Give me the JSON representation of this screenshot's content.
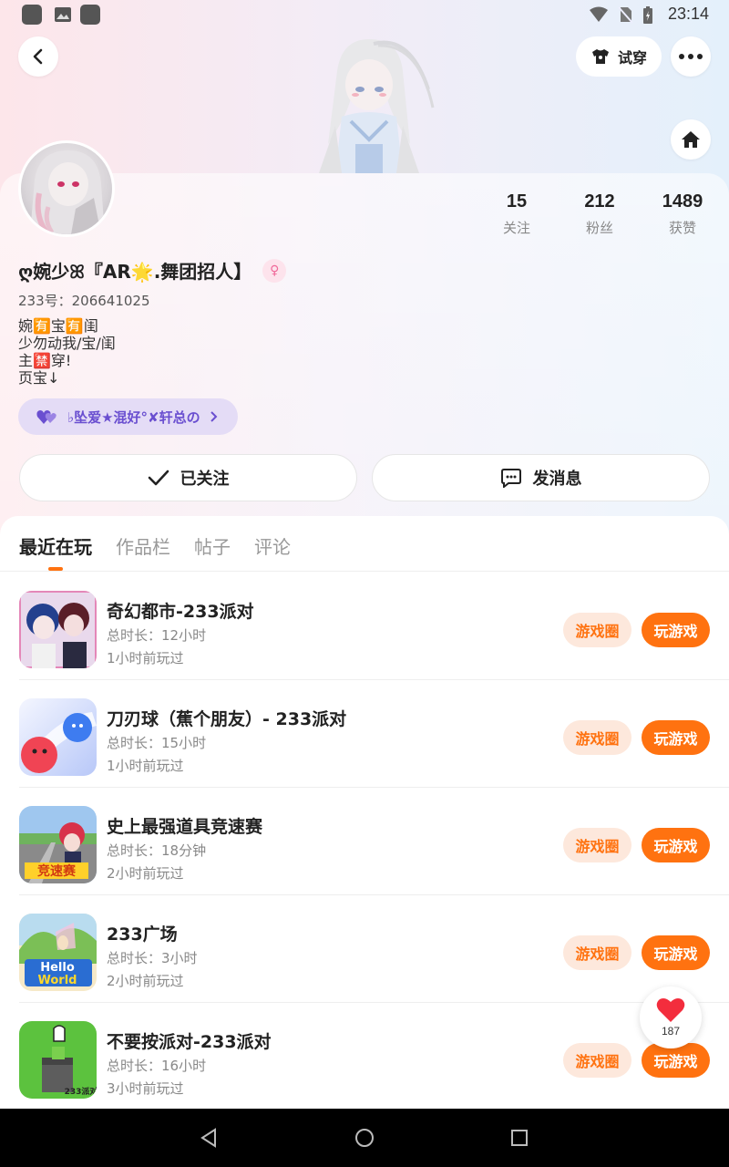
{
  "status_bar": {
    "time": "23:14"
  },
  "header": {
    "tryon_label": "试穿"
  },
  "profile": {
    "nickname": "ღ婉少ꕤ『AR🌟.舞团招人】",
    "gender_symbol": "♀",
    "uid": "233号：206641025",
    "bio_lines": [
      "婉🈶宝🈶闺",
      "少勿动我/宝/闺",
      "主🈲穿!",
      "页宝↓"
    ],
    "cp_tag": "♭坠爱★混好°✘轩总の"
  },
  "stats": [
    {
      "value": "15",
      "label": "关注"
    },
    {
      "value": "212",
      "label": "粉丝"
    },
    {
      "value": "1489",
      "label": "获赞"
    }
  ],
  "actions": {
    "follow_label": "已关注",
    "message_label": "发消息"
  },
  "tabs": [
    "最近在玩",
    "作品栏",
    "帖子",
    "评论"
  ],
  "games": [
    {
      "title": "奇幻都市-233派对",
      "duration": "总时长：12小时",
      "last_played": "1小时前玩过",
      "circle_label": "游戏圈",
      "play_label": "玩游戏"
    },
    {
      "title": "刀刃球（蕉个朋友）- 233派对",
      "duration": "总时长：15小时",
      "last_played": "1小时前玩过",
      "circle_label": "游戏圈",
      "play_label": "玩游戏"
    },
    {
      "title": "史上最强道具竞速赛",
      "duration": "总时长：18分钟",
      "last_played": "2小时前玩过",
      "circle_label": "游戏圈",
      "play_label": "玩游戏"
    },
    {
      "title": "233广场",
      "duration": "总时长：3小时",
      "last_played": "2小时前玩过",
      "circle_label": "游戏圈",
      "play_label": "玩游戏"
    },
    {
      "title": "不要按派对-233派对",
      "duration": "总时长：16小时",
      "last_played": "3小时前玩过",
      "circle_label": "游戏圈",
      "play_label": "玩游戏"
    }
  ],
  "like_fab": {
    "count": "187"
  },
  "colors": {
    "accent": "#ff7210",
    "accent_light": "#fde8dc",
    "cp_bg": "#e4dcf6"
  }
}
